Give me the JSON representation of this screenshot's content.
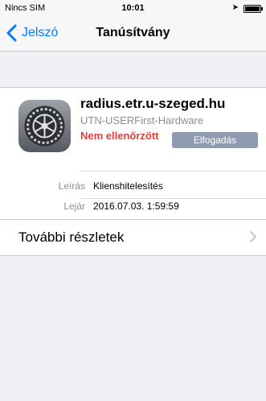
{
  "statusbar": {
    "carrier": "Nincs SIM",
    "time": "10:01",
    "location_icon": "location-arrow-icon",
    "battery_icon": "battery-icon"
  },
  "navbar": {
    "back_label": "Jelszó",
    "title": "Tanúsítvány"
  },
  "certificate": {
    "icon": "settings-gear-icon",
    "host": "radius.etr.u-szeged.hu",
    "issuer": "UTN-USERFirst-Hardware",
    "status": "Nem ellenőrzött",
    "accept_label": "Elfogadás",
    "details": [
      {
        "key": "Leírás",
        "value": "Klienshitelesítés"
      },
      {
        "key": "Lejár",
        "value": "2016.07.03. 1:59:59"
      }
    ]
  },
  "more": {
    "label": "További részletek"
  },
  "colors": {
    "accent": "#007aff",
    "warning": "#e0403d",
    "button": "#8f9bb0",
    "background": "#efeff4"
  }
}
